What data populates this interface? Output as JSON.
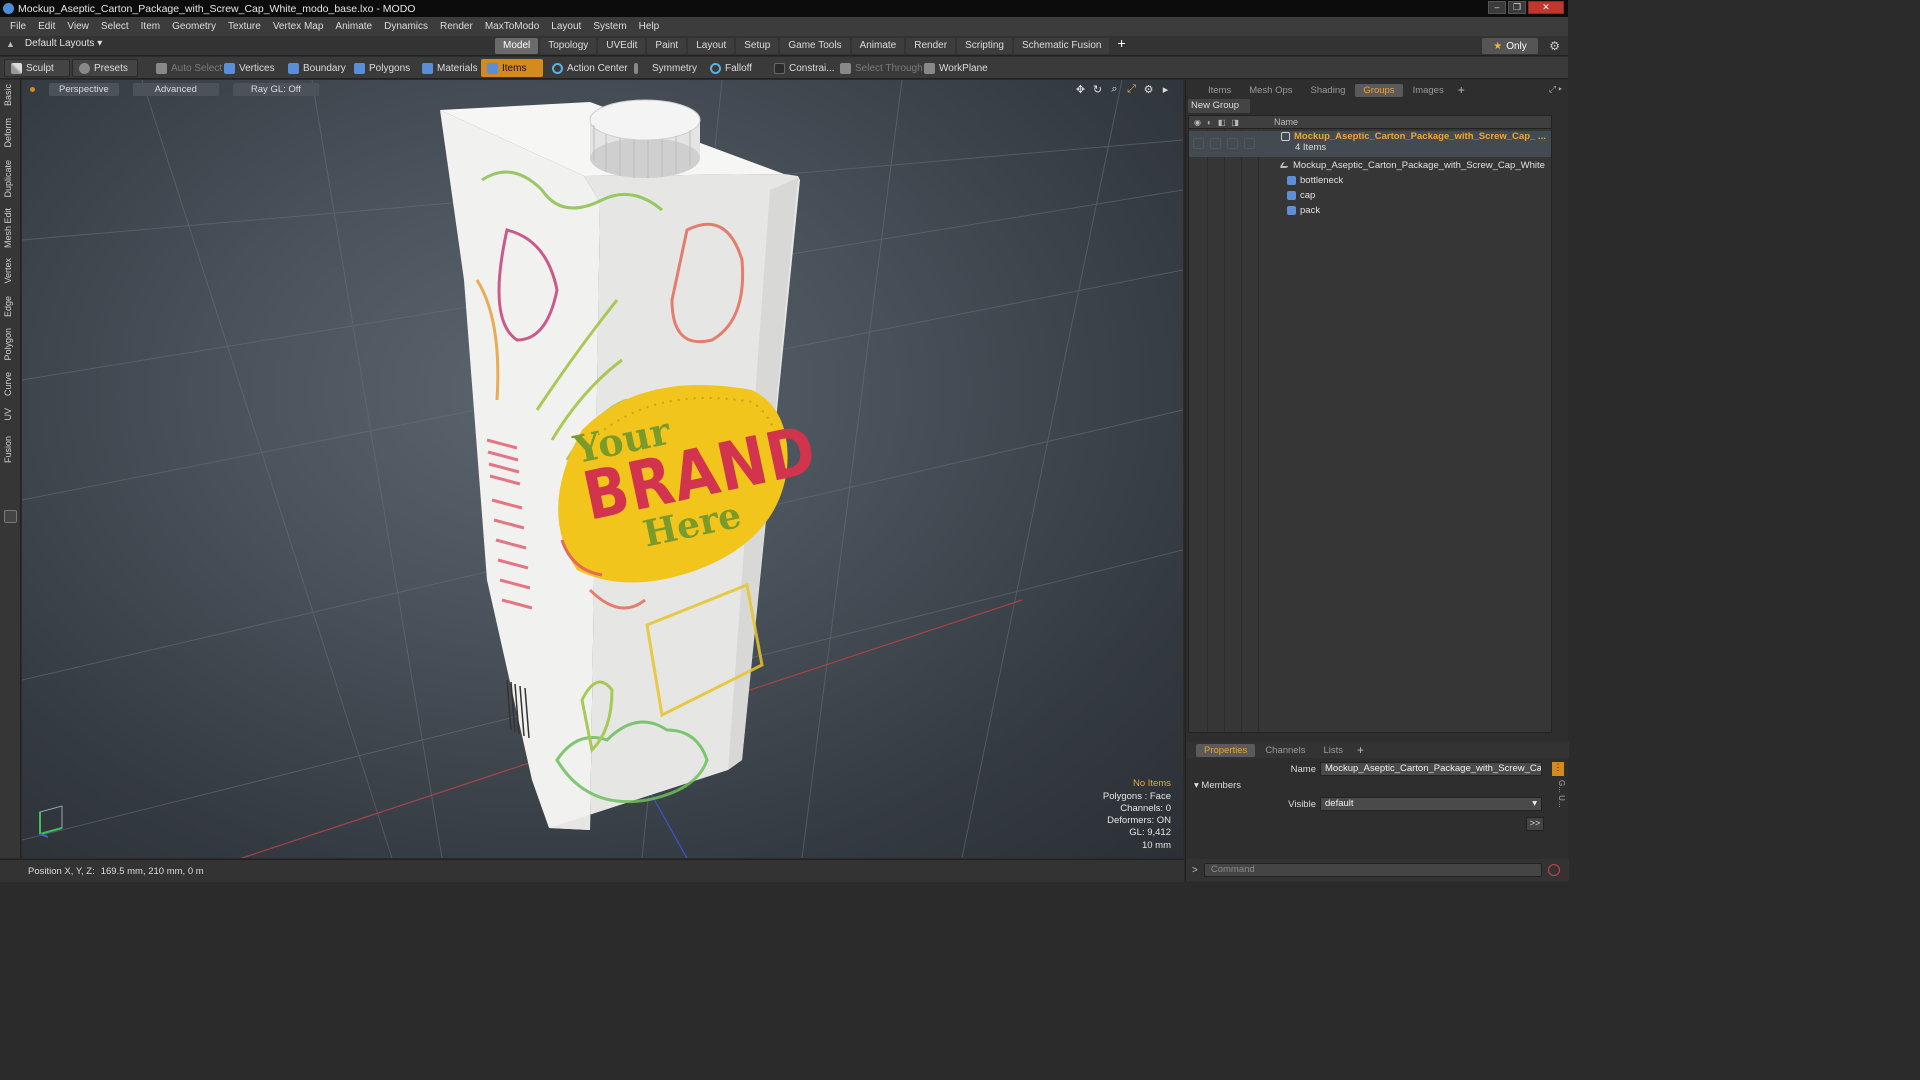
{
  "window": {
    "title": "Mockup_Aseptic_Carton_Package_with_Screw_Cap_White_modo_base.lxo - MODO",
    "controls": [
      "–",
      "❐",
      "✕"
    ]
  },
  "menu": [
    "File",
    "Edit",
    "View",
    "Select",
    "Item",
    "Geometry",
    "Texture",
    "Vertex Map",
    "Animate",
    "Dynamics",
    "Render",
    "MaxToModo",
    "Layout",
    "System",
    "Help"
  ],
  "layout_bar": {
    "layout_name": "Default Layouts ▾",
    "tabs": [
      "Model",
      "Topology",
      "UVEdit",
      "Paint",
      "Layout",
      "Setup",
      "Game Tools",
      "Animate",
      "Render",
      "Scripting",
      "Schematic Fusion"
    ],
    "active_tab": "Model",
    "plus": "+",
    "only_label": "Only"
  },
  "toolbar": {
    "sculpt": "Sculpt",
    "presets": "Presets",
    "auto_select": "Auto Select",
    "vertices": "Vertices",
    "boundary": "Boundary",
    "polygons": "Polygons",
    "materials": "Materials",
    "items": "Items",
    "action_center": "Action Center",
    "symmetry": "Symmetry",
    "falloff": "Falloff",
    "constraints": "Constrai...",
    "select_through": "Select Through",
    "workplane": "WorkPlane"
  },
  "left_tabs": [
    "Basic",
    "Deform",
    "Duplicate",
    "Mesh Edit",
    "Vertex",
    "Edge",
    "Polygon",
    "Curve",
    "UV",
    "Fusion"
  ],
  "viewport": {
    "view_mode": "Perspective",
    "shading": "Advanced",
    "raygl": "Ray GL: Off",
    "stats": {
      "items": "No Items",
      "polygons": "Polygons : Face",
      "channels": "Channels: 0",
      "deformers": "Deformers: ON",
      "gl": "GL: 9,412",
      "grid": "10 mm"
    },
    "label_text": {
      "your": "Your",
      "brand": "BRAND",
      "here": "Here"
    }
  },
  "status": {
    "label": "Position X, Y, Z:",
    "value": "169.5 mm, 210 mm, 0 m"
  },
  "right_panel": {
    "tabs": [
      "Items",
      "Mesh Ops",
      "Shading",
      "Groups",
      "Images"
    ],
    "active_tab": "Groups",
    "new_group": "New Group",
    "name_col": "Name",
    "group": {
      "name": "Mockup_Aseptic_Carton_Package_with_Screw_Cap_ ...",
      "count": "4 Items",
      "children": [
        "Mockup_Aseptic_Carton_Package_with_Screw_Cap_White",
        "bottleneck",
        "cap",
        "pack"
      ]
    },
    "props_tabs": [
      "Properties",
      "Channels",
      "Lists"
    ],
    "props_active": "Properties",
    "name_label": "Name",
    "name_value": "Mockup_Aseptic_Carton_Package_with_Screw_Cap_W",
    "members": "Members",
    "visible_label": "Visible",
    "visible_value": "default",
    "arrow": ">>",
    "command_placeholder": "Command"
  },
  "colors": {
    "accent": "#d58a1e",
    "group_name": "#f0a537",
    "stats_highlight": "#e4a83c",
    "title_bg": "#0c0c0c"
  }
}
